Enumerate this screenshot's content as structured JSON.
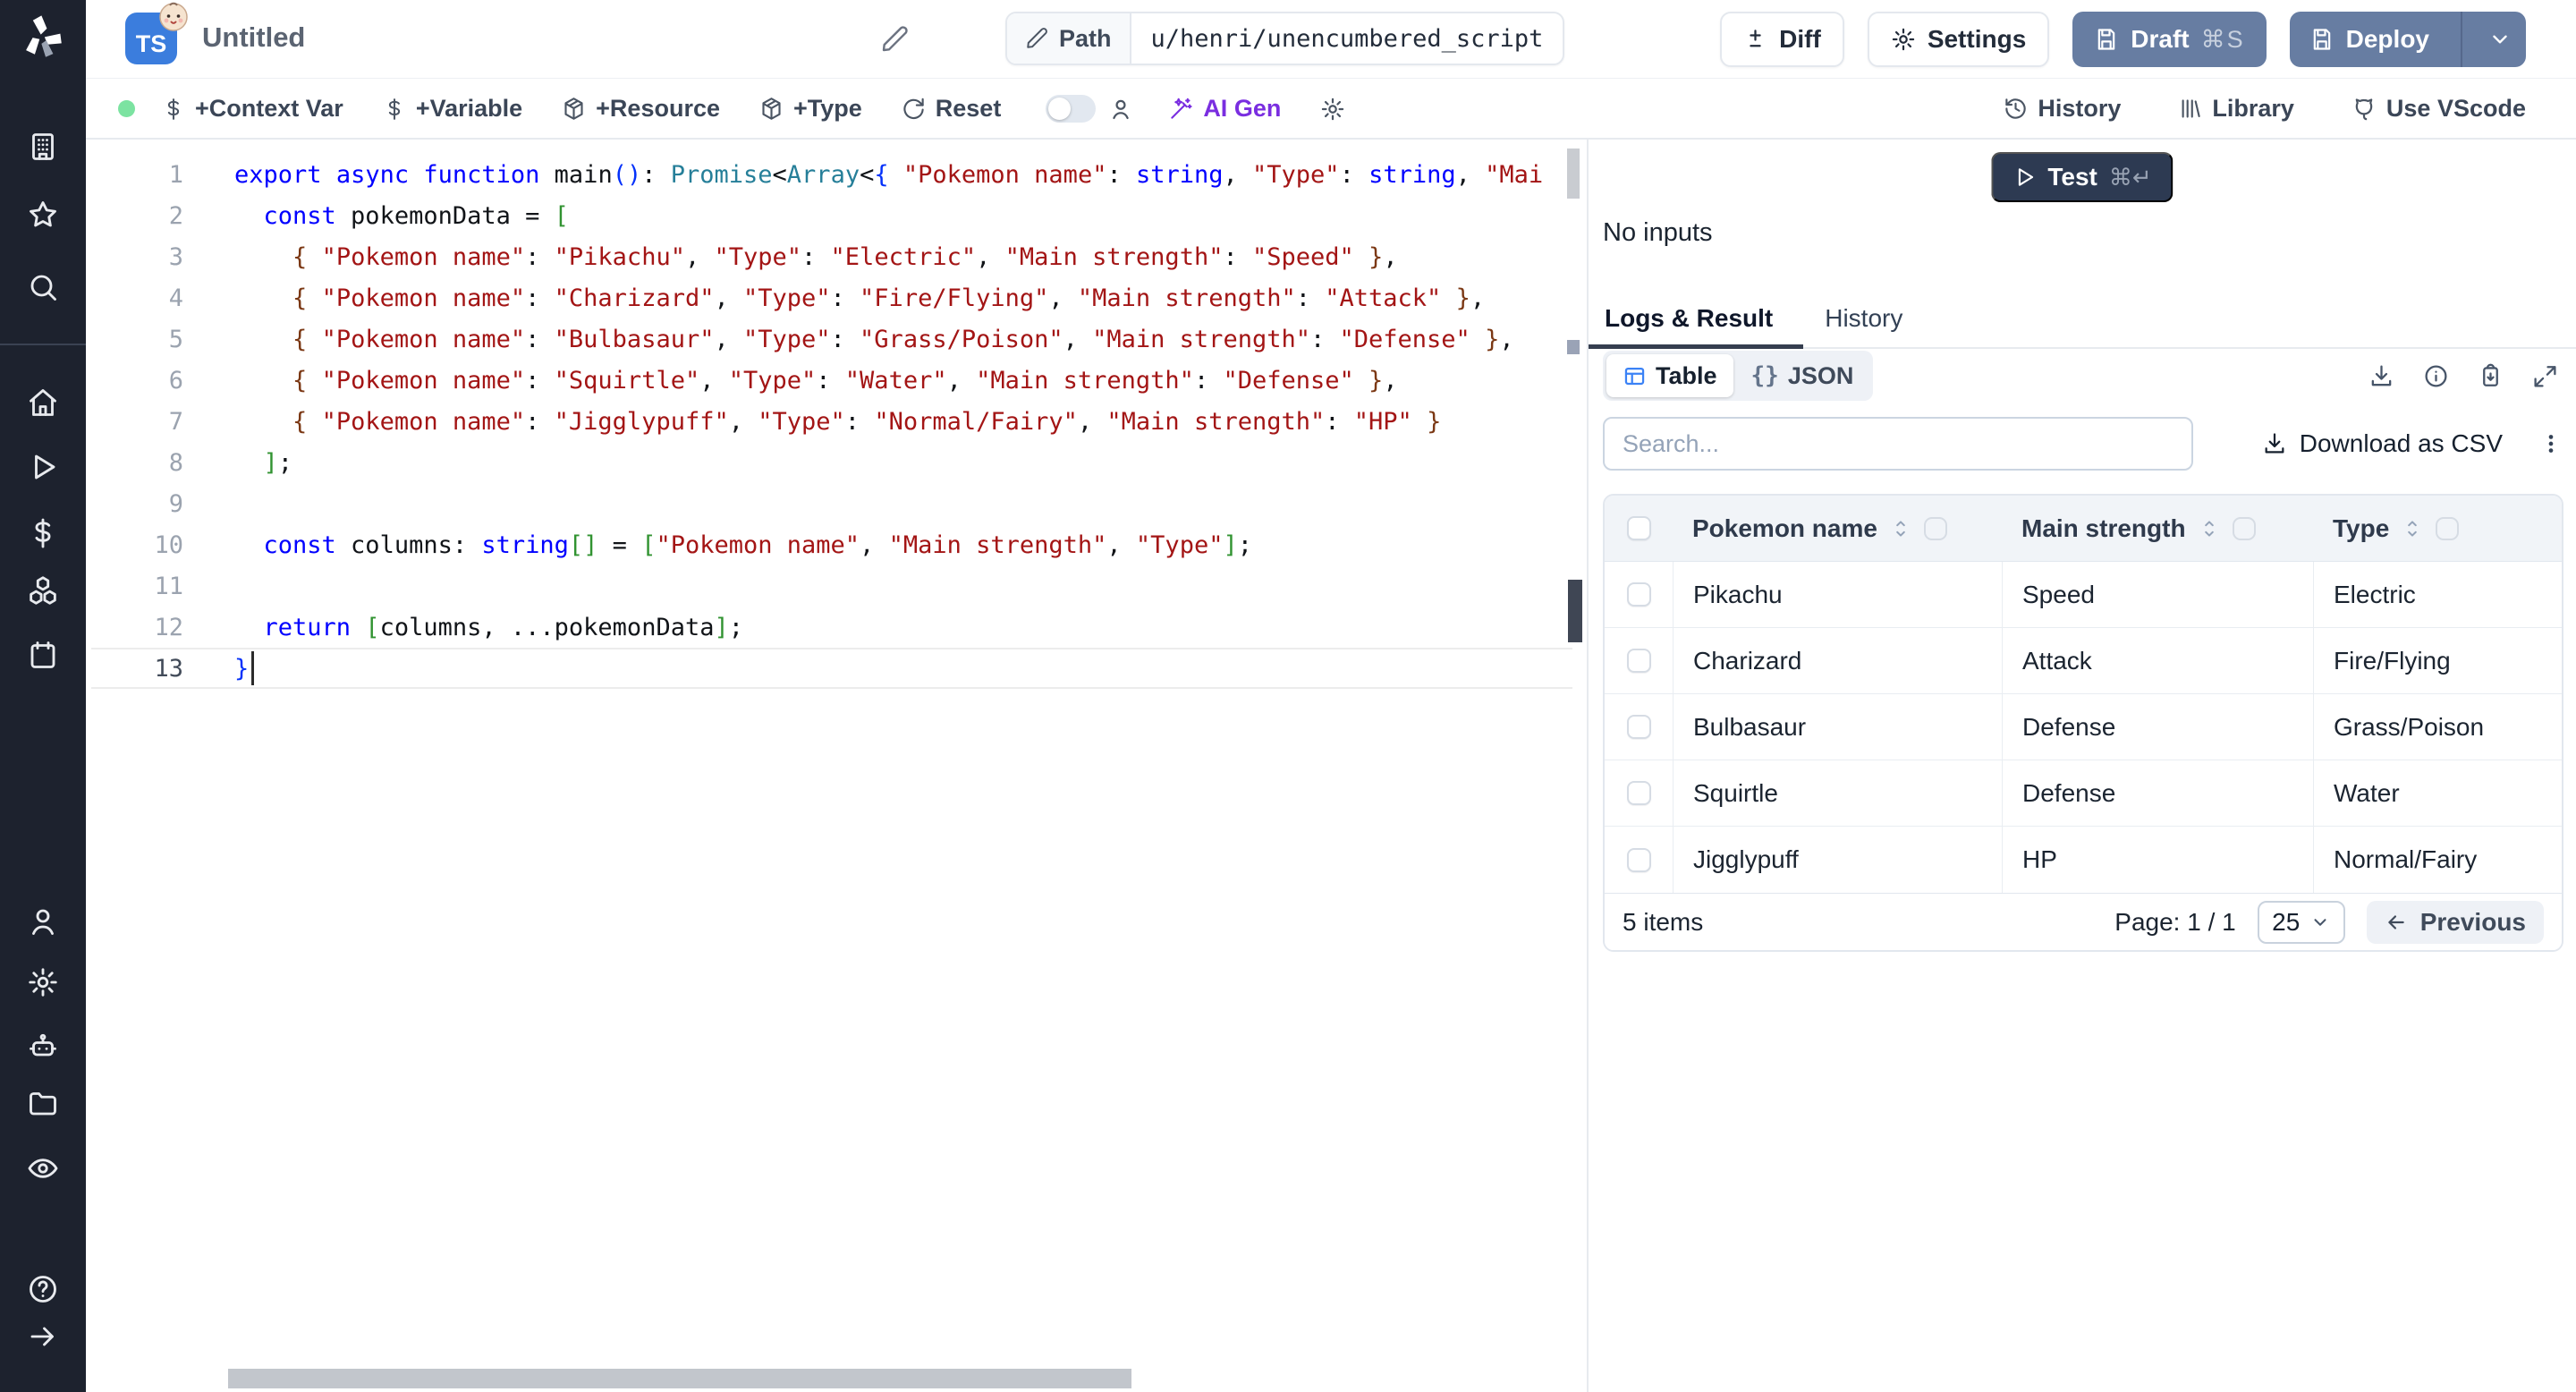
{
  "header": {
    "lang_badge": "TS",
    "title": "Untitled",
    "path_label": "Path",
    "path_value": "u/henri/unencumbered_script",
    "diff_label": "Diff",
    "settings_label": "Settings",
    "draft_label": "Draft",
    "draft_shortcut": "⌘S",
    "deploy_label": "Deploy"
  },
  "toolbar": {
    "context_var_label": "+Context Var",
    "variable_label": "+Variable",
    "resource_label": "+Resource",
    "type_label": "+Type",
    "reset_label": "Reset",
    "ai_gen_label": "AI Gen",
    "history_label": "History",
    "library_label": "Library",
    "vscode_label": "Use VScode"
  },
  "sidebar": {
    "icons": [
      "building",
      "star",
      "search",
      "home",
      "play",
      "dollar",
      "boxes",
      "calendar",
      "person",
      "gear",
      "robot",
      "folder",
      "eye",
      "help-circle",
      "arrow-right"
    ]
  },
  "editor": {
    "active_line": 13,
    "lines": [
      {
        "num": "1",
        "segs": [
          [
            "k",
            "export"
          ],
          [
            "p",
            " "
          ],
          [
            "k",
            "async"
          ],
          [
            "p",
            " "
          ],
          [
            "k",
            "function"
          ],
          [
            "p",
            " "
          ],
          [
            "p",
            "main"
          ],
          [
            "b1",
            "()"
          ],
          [
            "p",
            ": "
          ],
          [
            "t",
            "Promise"
          ],
          [
            "p",
            "<"
          ],
          [
            "t",
            "Array"
          ],
          [
            "p",
            "<"
          ],
          [
            "b1",
            "{"
          ],
          [
            "p",
            " "
          ],
          [
            "s",
            "\"Pokemon name\""
          ],
          [
            "p",
            ": "
          ],
          [
            "k",
            "string"
          ],
          [
            "p",
            ", "
          ],
          [
            "s",
            "\"Type\""
          ],
          [
            "p",
            ": "
          ],
          [
            "k",
            "string"
          ],
          [
            "p",
            ", "
          ],
          [
            "s",
            "\"Mai"
          ]
        ]
      },
      {
        "num": "2",
        "segs": [
          [
            "p",
            "  "
          ],
          [
            "k",
            "const"
          ],
          [
            "p",
            " pokemonData = "
          ],
          [
            "b2",
            "["
          ]
        ]
      },
      {
        "num": "3",
        "segs": [
          [
            "p",
            "    "
          ],
          [
            "b3",
            "{"
          ],
          [
            "p",
            " "
          ],
          [
            "s",
            "\"Pokemon name\""
          ],
          [
            "p",
            ": "
          ],
          [
            "s",
            "\"Pikachu\""
          ],
          [
            "p",
            ", "
          ],
          [
            "s",
            "\"Type\""
          ],
          [
            "p",
            ": "
          ],
          [
            "s",
            "\"Electric\""
          ],
          [
            "p",
            ", "
          ],
          [
            "s",
            "\"Main strength\""
          ],
          [
            "p",
            ": "
          ],
          [
            "s",
            "\"Speed\""
          ],
          [
            "p",
            " "
          ],
          [
            "b3",
            "}"
          ],
          [
            "p",
            ","
          ]
        ]
      },
      {
        "num": "4",
        "segs": [
          [
            "p",
            "    "
          ],
          [
            "b3",
            "{"
          ],
          [
            "p",
            " "
          ],
          [
            "s",
            "\"Pokemon name\""
          ],
          [
            "p",
            ": "
          ],
          [
            "s",
            "\"Charizard\""
          ],
          [
            "p",
            ", "
          ],
          [
            "s",
            "\"Type\""
          ],
          [
            "p",
            ": "
          ],
          [
            "s",
            "\"Fire/Flying\""
          ],
          [
            "p",
            ", "
          ],
          [
            "s",
            "\"Main strength\""
          ],
          [
            "p",
            ": "
          ],
          [
            "s",
            "\"Attack\""
          ],
          [
            "p",
            " "
          ],
          [
            "b3",
            "}"
          ],
          [
            "p",
            ","
          ]
        ]
      },
      {
        "num": "5",
        "segs": [
          [
            "p",
            "    "
          ],
          [
            "b3",
            "{"
          ],
          [
            "p",
            " "
          ],
          [
            "s",
            "\"Pokemon name\""
          ],
          [
            "p",
            ": "
          ],
          [
            "s",
            "\"Bulbasaur\""
          ],
          [
            "p",
            ", "
          ],
          [
            "s",
            "\"Type\""
          ],
          [
            "p",
            ": "
          ],
          [
            "s",
            "\"Grass/Poison\""
          ],
          [
            "p",
            ", "
          ],
          [
            "s",
            "\"Main strength\""
          ],
          [
            "p",
            ": "
          ],
          [
            "s",
            "\"Defense\""
          ],
          [
            "p",
            " "
          ],
          [
            "b3",
            "}"
          ],
          [
            "p",
            ","
          ]
        ]
      },
      {
        "num": "6",
        "segs": [
          [
            "p",
            "    "
          ],
          [
            "b3",
            "{"
          ],
          [
            "p",
            " "
          ],
          [
            "s",
            "\"Pokemon name\""
          ],
          [
            "p",
            ": "
          ],
          [
            "s",
            "\"Squirtle\""
          ],
          [
            "p",
            ", "
          ],
          [
            "s",
            "\"Type\""
          ],
          [
            "p",
            ": "
          ],
          [
            "s",
            "\"Water\""
          ],
          [
            "p",
            ", "
          ],
          [
            "s",
            "\"Main strength\""
          ],
          [
            "p",
            ": "
          ],
          [
            "s",
            "\"Defense\""
          ],
          [
            "p",
            " "
          ],
          [
            "b3",
            "}"
          ],
          [
            "p",
            ","
          ]
        ]
      },
      {
        "num": "7",
        "segs": [
          [
            "p",
            "    "
          ],
          [
            "b3",
            "{"
          ],
          [
            "p",
            " "
          ],
          [
            "s",
            "\"Pokemon name\""
          ],
          [
            "p",
            ": "
          ],
          [
            "s",
            "\"Jigglypuff\""
          ],
          [
            "p",
            ", "
          ],
          [
            "s",
            "\"Type\""
          ],
          [
            "p",
            ": "
          ],
          [
            "s",
            "\"Normal/Fairy\""
          ],
          [
            "p",
            ", "
          ],
          [
            "s",
            "\"Main strength\""
          ],
          [
            "p",
            ": "
          ],
          [
            "s",
            "\"HP\""
          ],
          [
            "p",
            " "
          ],
          [
            "b3",
            "}"
          ]
        ]
      },
      {
        "num": "8",
        "segs": [
          [
            "p",
            "  "
          ],
          [
            "b2",
            "]"
          ],
          [
            "p",
            ";"
          ]
        ]
      },
      {
        "num": "9",
        "segs": []
      },
      {
        "num": "10",
        "segs": [
          [
            "p",
            "  "
          ],
          [
            "k",
            "const"
          ],
          [
            "p",
            " columns: "
          ],
          [
            "k",
            "string"
          ],
          [
            "b2",
            "[]"
          ],
          [
            "p",
            " = "
          ],
          [
            "b2",
            "["
          ],
          [
            "s",
            "\"Pokemon name\""
          ],
          [
            "p",
            ", "
          ],
          [
            "s",
            "\"Main strength\""
          ],
          [
            "p",
            ", "
          ],
          [
            "s",
            "\"Type\""
          ],
          [
            "b2",
            "]"
          ],
          [
            "p",
            ";"
          ]
        ]
      },
      {
        "num": "11",
        "segs": []
      },
      {
        "num": "12",
        "segs": [
          [
            "p",
            "  "
          ],
          [
            "k",
            "return"
          ],
          [
            "p",
            " "
          ],
          [
            "b2",
            "["
          ],
          [
            "p",
            "columns, ...pokemonData"
          ],
          [
            "b2",
            "]"
          ],
          [
            "p",
            ";"
          ]
        ]
      },
      {
        "num": "13",
        "segs": [
          [
            "b1",
            "}"
          ]
        ]
      }
    ]
  },
  "panel": {
    "test_label": "Test",
    "test_shortcut": "⌘↵",
    "no_inputs": "No inputs",
    "tabs": {
      "logs": "Logs & Result",
      "history": "History"
    },
    "view_toggle": {
      "table": "Table",
      "json": "JSON",
      "json_glyph": "{}"
    },
    "search_placeholder": "Search...",
    "download_csv_label": "Download as CSV",
    "result_table": {
      "columns": [
        "Pokemon name",
        "Main strength",
        "Type"
      ],
      "rows": [
        [
          "Pikachu",
          "Speed",
          "Electric"
        ],
        [
          "Charizard",
          "Attack",
          "Fire/Flying"
        ],
        [
          "Bulbasaur",
          "Defense",
          "Grass/Poison"
        ],
        [
          "Squirtle",
          "Defense",
          "Water"
        ],
        [
          "Jigglypuff",
          "HP",
          "Normal/Fairy"
        ]
      ]
    },
    "pagination": {
      "items_label": "5 items",
      "page_label": "Page: 1 / 1",
      "page_size": "25",
      "previous_label": "Previous"
    }
  },
  "colors": {
    "accent_slate": "#677da2",
    "test_navy": "#2d3a52",
    "ai_purple": "#7a2ee0",
    "table_icon_blue": "#3b82f6",
    "status_green": "#7ce3a1",
    "ts_blue": "#3b7ddd"
  }
}
